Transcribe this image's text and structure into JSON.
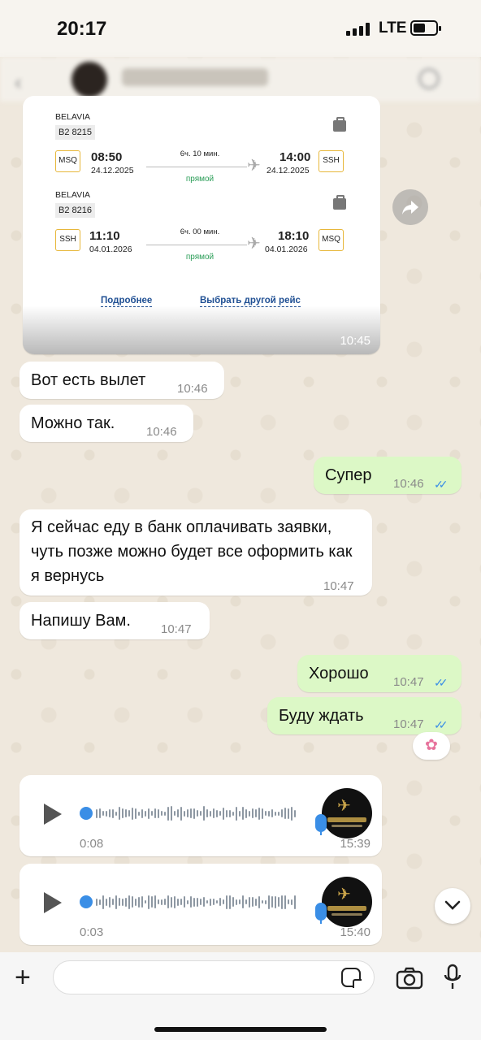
{
  "status_bar": {
    "time": "20:17",
    "network": "LTE"
  },
  "ticket": {
    "segments": [
      {
        "airline": "BELAVIA",
        "flight_no": "B2 8215",
        "from_code": "MSQ",
        "dep_time": "08:50",
        "dep_date": "24.12.2025",
        "duration": "6ч. 10 мин.",
        "type": "прямой",
        "arr_time": "14:00",
        "arr_date": "24.12.2025",
        "to_code": "SSH"
      },
      {
        "airline": "BELAVIA",
        "flight_no": "B2 8216",
        "from_code": "SSH",
        "dep_time": "11:10",
        "dep_date": "04.01.2026",
        "duration": "6ч. 00 мин.",
        "type": "прямой",
        "arr_time": "18:10",
        "arr_date": "04.01.2026",
        "to_code": "MSQ"
      }
    ],
    "details_link": "Подробнее",
    "other_flight_link": "Выбрать другой рейс",
    "time": "10:45"
  },
  "messages": [
    {
      "dir": "in",
      "text": "Вот есть вылет",
      "time": "10:46"
    },
    {
      "dir": "in",
      "text": "Можно так.",
      "time": "10:46"
    },
    {
      "dir": "out",
      "text": "Супер",
      "time": "10:46"
    },
    {
      "dir": "in",
      "text": "Я сейчас еду в банк оплачивать заявки, чуть позже можно будет все оформить как я вернусь",
      "time": "10:47"
    },
    {
      "dir": "in",
      "text": "Напишу Вам.",
      "time": "10:47"
    },
    {
      "dir": "out",
      "text": "Хорошо",
      "time": "10:47"
    },
    {
      "dir": "out",
      "text": "Буду ждать",
      "time": "10:47"
    }
  ],
  "reaction": "flower-emoji",
  "voice_notes": [
    {
      "duration": "0:08",
      "time": "15:39"
    },
    {
      "duration": "0:03",
      "time": "15:40"
    }
  ],
  "composer": {
    "placeholder": ""
  },
  "colors": {
    "incoming": "#ffffff",
    "outgoing": "#dcf8c6",
    "read_ticks": "#3a8ee6",
    "accent_border": "#e7b73a"
  }
}
